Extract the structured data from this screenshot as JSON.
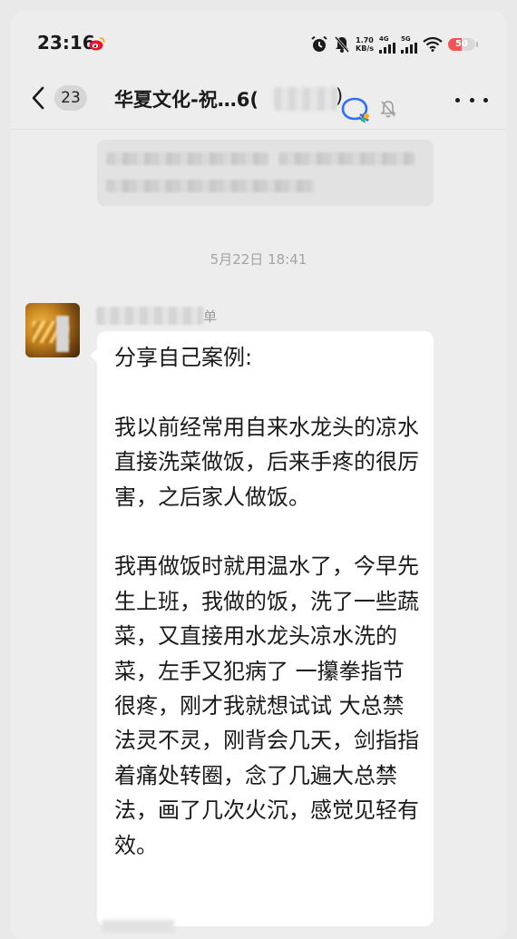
{
  "status_bar": {
    "time": "23:16",
    "app_icon": "weibo-icon",
    "net_speed_value": "1.70",
    "net_speed_unit": "KB/s",
    "signal_1_label": "4G",
    "signal_2_label": "5G",
    "battery_level": "50",
    "battery_fraction": 0.5,
    "battery_color": "#f25454",
    "icons": [
      "alarm-icon",
      "mute-bell-icon",
      "signal-4g-icon",
      "signal-5g-icon",
      "wifi-icon",
      "battery-icon"
    ]
  },
  "header": {
    "back_icon": "chevron-left-icon",
    "unread_count": "23",
    "title": "华夏文化-祝…6(",
    "title_close_paren": ")",
    "icons": [
      "chatbot-icon",
      "mute-bell-icon",
      "more-icon"
    ]
  },
  "messages": {
    "timestamp": "5月22日 18:41",
    "sender_name_suffix": "单",
    "body": "分享自己案例:\n\n我以前经常用自来水龙头的凉水直接洗菜做饭，后来手疼的很厉害，之后家人做饭。\n\n我再做饭时就用温水了，今早先生上班，我做的饭，洗了一些蔬菜，又直接用水龙头凉水洗的菜，左手又犯病了 一攥拳指节很疼，刚才我就想试试 大总禁法灵不灵，刚背会几天，剑指指着痛处转圈，念了几遍大总禁法，画了几次火沉，感觉见轻有效。"
  },
  "colors": {
    "background": "#ededed",
    "bubble": "#ffffff",
    "timestamp": "#a4a4a4",
    "accent_blue": "#2f6bff"
  }
}
